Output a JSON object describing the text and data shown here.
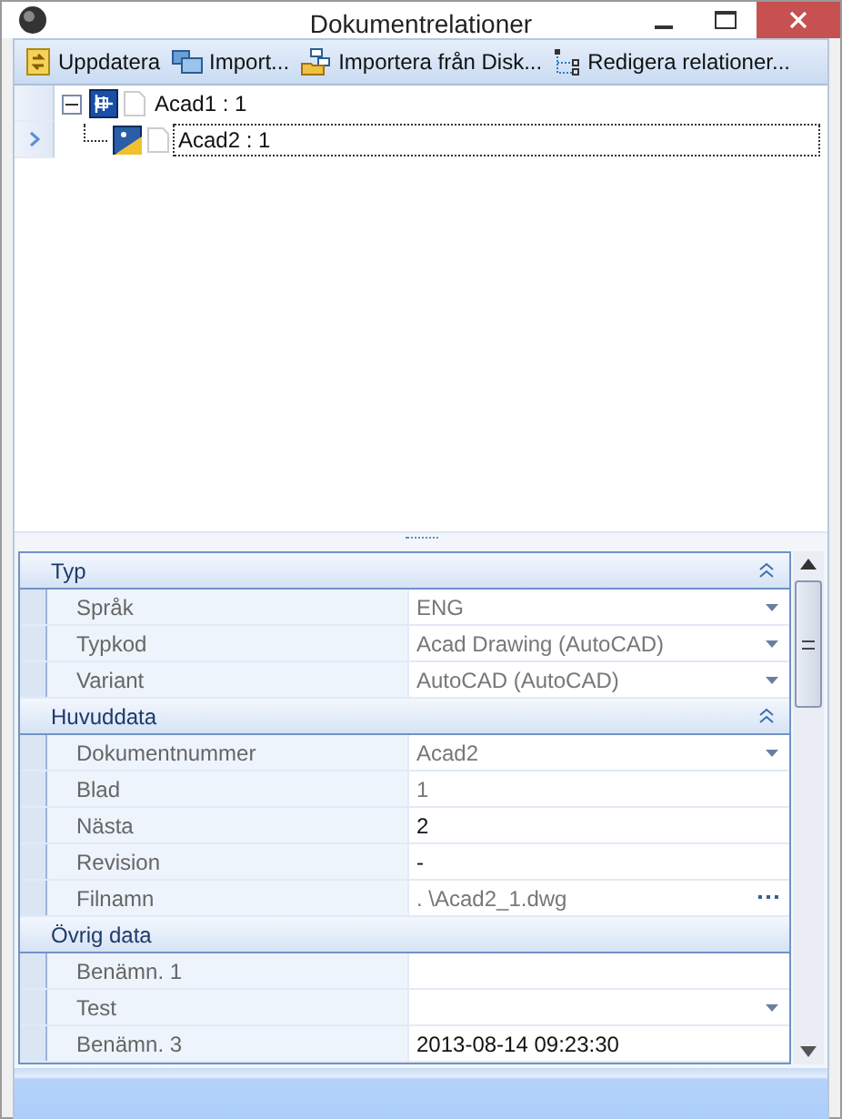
{
  "window": {
    "title": "Dokumentrelationer"
  },
  "toolbar": [
    {
      "label": "Uppdatera",
      "kind": "refresh"
    },
    {
      "label": "Import...",
      "kind": "import"
    },
    {
      "label": "Importera från Disk...",
      "kind": "disk"
    },
    {
      "label": "Redigera relationer...",
      "kind": "relations"
    }
  ],
  "tree": [
    {
      "label": "Acad1 : 1",
      "expanded": true,
      "selected": false,
      "kind": "assembly",
      "children": [
        {
          "label": "Acad2 : 1",
          "selected": true,
          "kind": "drawing"
        }
      ]
    }
  ],
  "properties": [
    {
      "category": "Typ",
      "expanded": true,
      "rows": [
        {
          "name": "Språk",
          "value": "ENG",
          "readonly": true,
          "kind": "dropdown"
        },
        {
          "name": "Typkod",
          "value": "Acad Drawing (AutoCAD)",
          "readonly": true,
          "kind": "dropdown"
        },
        {
          "name": "Variant",
          "value": "AutoCAD (AutoCAD)",
          "readonly": true,
          "kind": "dropdown"
        }
      ]
    },
    {
      "category": "Huvuddata",
      "expanded": true,
      "rows": [
        {
          "name": "Dokumentnummer",
          "value": "Acad2",
          "readonly": true,
          "kind": "dropdown"
        },
        {
          "name": "Blad",
          "value": "1",
          "readonly": true,
          "kind": "text"
        },
        {
          "name": "Nästa",
          "value": "2",
          "readonly": false,
          "kind": "text"
        },
        {
          "name": "Revision",
          "value": "-",
          "readonly": false,
          "kind": "text"
        },
        {
          "name": "Filnamn",
          "value": ". \\Acad2_1.dwg",
          "readonly": true,
          "kind": "ellipsis"
        }
      ]
    },
    {
      "category": "Övrig data",
      "rows": [
        {
          "name": "Benämn. 1",
          "kind": "text"
        },
        {
          "name": "Test",
          "kind": "dropdown"
        },
        {
          "name": "Benämn. 3",
          "value": "2013-08-14 09:23:30",
          "readonly": false,
          "kind": "text"
        }
      ]
    }
  ]
}
